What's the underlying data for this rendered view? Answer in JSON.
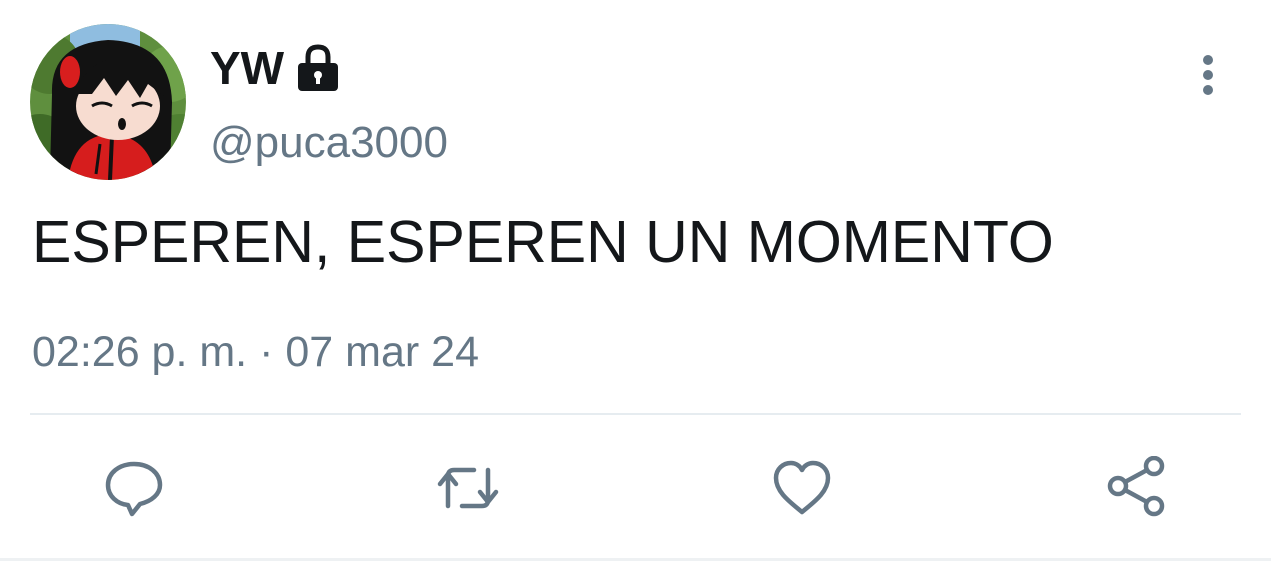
{
  "tweet": {
    "display_name": "YW",
    "handle": "@puca3000",
    "text": "ESPEREN, ESPEREN UN MOMENTO",
    "time": "02:26 p. m.",
    "separator": "·",
    "date": "07 mar 24",
    "protected": true
  },
  "icons": {
    "lock": "lock-icon",
    "more": "more-vertical-icon",
    "reply": "reply-icon",
    "retweet": "retweet-icon",
    "like": "heart-icon",
    "share": "share-icon"
  },
  "colors": {
    "text_primary": "#14171a",
    "text_secondary": "#657786",
    "icon": "#657786",
    "divider": "#e6ecf0"
  }
}
